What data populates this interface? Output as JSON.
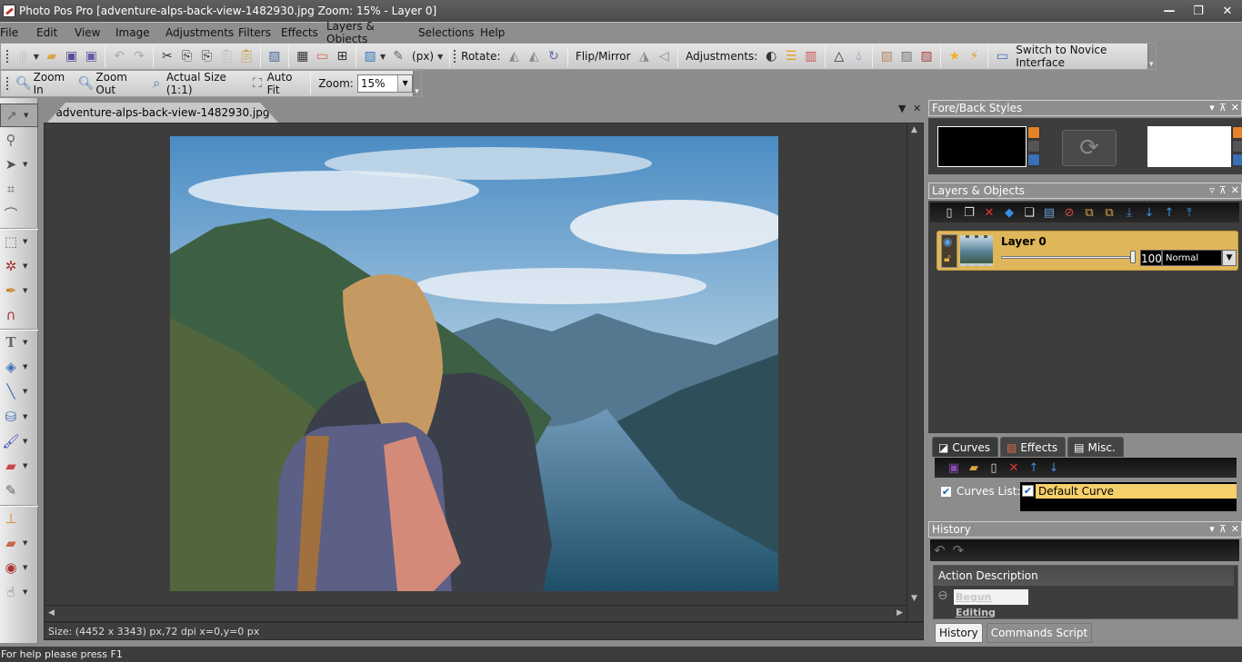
{
  "window": {
    "title": "Photo Pos Pro [adventure-alps-back-view-1482930.jpg Zoom: 15% - Layer 0]",
    "controls": [
      "minimize",
      "restore",
      "close"
    ]
  },
  "menu": [
    "File",
    "Edit",
    "View",
    "Image",
    "Adjustments",
    "Filters",
    "Effects",
    "Layers & Objects",
    "Selections",
    "Help"
  ],
  "toolbar1": {
    "unit_label": "(px)",
    "rotate_label": "Rotate:",
    "flip_label": "Flip/Mirror",
    "adjust_label": "Adjustments:",
    "novice_label": "Switch to Novice Interface"
  },
  "toolbar2": {
    "zoom_in": "Zoom In",
    "zoom_out": "Zoom Out",
    "actual_size": "Actual Size (1:1)",
    "auto_fit": "Auto Fit",
    "zoom_label": "Zoom:",
    "zoom_value": "15%"
  },
  "document": {
    "tab_name": "adventure-alps-back-view-1482930.jpg",
    "info": "Size: (4452 x 3343) px,72 dpi   x=0,y=0 px"
  },
  "status": "For help please press F1",
  "panels": {
    "foreback": {
      "title": "Fore/Back Styles",
      "fore_color": "#000000",
      "back_color": "#ffffff"
    },
    "layers": {
      "title": "Layers & Objects",
      "items": [
        {
          "name": "Layer 0",
          "opacity": "100",
          "blend": "Normal"
        }
      ]
    },
    "tabs": [
      "Curves",
      "Effects",
      "Misc."
    ],
    "curves": {
      "list_label": "Curves List:",
      "items": [
        "Default Curve"
      ]
    },
    "history": {
      "title": "History",
      "column": "Action Description",
      "items": [
        "Begun Editing"
      ],
      "tabs": [
        "History",
        "Commands Script"
      ]
    }
  }
}
